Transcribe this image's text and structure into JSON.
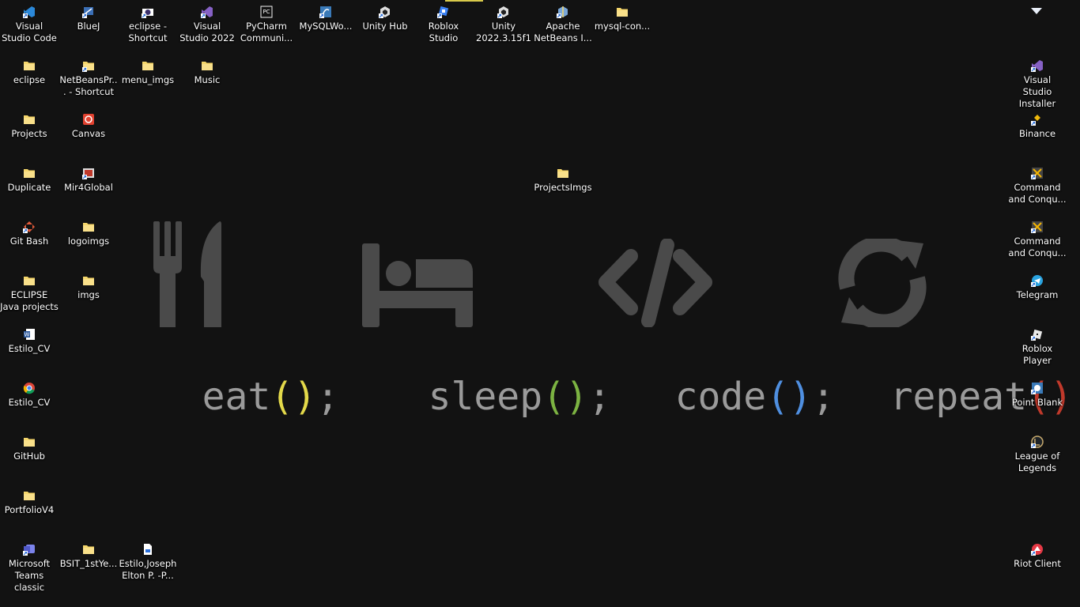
{
  "wallpaper": {
    "words": [
      {
        "name": "eat",
        "text": "eat",
        "open": "(",
        "close": ")",
        "semi": ";",
        "paren_color": "#e3d94a",
        "icon": "fork-knife-icon"
      },
      {
        "name": "sleep",
        "text": "sleep",
        "open": "(",
        "close": ")",
        "semi": ";",
        "paren_color": "#7cb342",
        "icon": "bed-icon"
      },
      {
        "name": "code",
        "text": "code",
        "open": "(",
        "close": ")",
        "semi": ";",
        "paren_color": "#4f8fe0",
        "icon": "code-brackets-icon"
      },
      {
        "name": "repeat",
        "text": "repeat",
        "open": "(",
        "close": ")",
        "semi": ";",
        "paren_color": "#c0392b",
        "icon": "refresh-icon"
      }
    ],
    "icon_color": "#4a4a4a",
    "text_color": "#9a9a9a"
  },
  "desktop": {
    "icons": [
      {
        "id": "vscode",
        "label": "Visual Studio Code",
        "icon": "vscode-icon",
        "color": "#2b88d8"
      },
      {
        "id": "bluej",
        "label": "BlueJ",
        "icon": "bluej-icon",
        "color": "#3b6fb6"
      },
      {
        "id": "eclipse-shortcut",
        "label": "eclipse - Shortcut",
        "icon": "eclipse-icon",
        "color": "#3a2f6b"
      },
      {
        "id": "vs2022",
        "label": "Visual Studio 2022",
        "icon": "visual-studio-icon",
        "color": "#8661c5"
      },
      {
        "id": "pycharm",
        "label": "PyCharm Communi...",
        "icon": "pycharm-icon",
        "color": "#f2f2f2"
      },
      {
        "id": "mysql-workbench",
        "label": "MySQLWo...",
        "icon": "mysql-workbench-icon",
        "color": "#3a7ab8"
      },
      {
        "id": "unity-hub",
        "label": "Unity Hub",
        "icon": "unity-hub-icon",
        "color": "#dddddd"
      },
      {
        "id": "roblox-studio",
        "label": "Roblox Studio",
        "icon": "roblox-studio-icon",
        "color": "#3b82f6"
      },
      {
        "id": "unity",
        "label": "Unity 2022.3.15f1",
        "icon": "unity-icon",
        "color": "#dddddd"
      },
      {
        "id": "netbeans",
        "label": "Apache NetBeans I...",
        "icon": "netbeans-icon",
        "color": "#7aa7d8"
      },
      {
        "id": "mysql-con",
        "label": "mysql-con...",
        "icon": "folder-icon",
        "color": "#f5d66b"
      },
      {
        "id": "eclipse-folder",
        "label": "eclipse",
        "icon": "folder-icon",
        "color": "#f5d66b"
      },
      {
        "id": "netbeanspr",
        "label": "NetBeansPr... - Shortcut",
        "icon": "folder-shortcut-icon",
        "color": "#f5d66b"
      },
      {
        "id": "menu-imgs",
        "label": "menu_imgs",
        "icon": "folder-icon",
        "color": "#f5d66b"
      },
      {
        "id": "music",
        "label": "Music",
        "icon": "folder-icon",
        "color": "#f5d66b"
      },
      {
        "id": "projects",
        "label": "Projects",
        "icon": "folder-icon",
        "color": "#f5d66b"
      },
      {
        "id": "canvas",
        "label": "Canvas",
        "icon": "canvas-icon",
        "color": "#e2412f"
      },
      {
        "id": "duplicate",
        "label": "Duplicate",
        "icon": "folder-icon",
        "color": "#f5d66b"
      },
      {
        "id": "mir4global",
        "label": "Mir4Global",
        "icon": "mir4-icon",
        "color": "#cccccc"
      },
      {
        "id": "projectsimgs",
        "label": "ProjectsImgs",
        "icon": "folder-icon",
        "color": "#f5d66b"
      },
      {
        "id": "gitbash",
        "label": "Git Bash",
        "icon": "git-bash-icon",
        "color": "#e05a3a"
      },
      {
        "id": "logoimgs",
        "label": "logoimgs",
        "icon": "folder-icon",
        "color": "#f5d66b"
      },
      {
        "id": "eclipse-java",
        "label": "ECLIPSE Java projects",
        "icon": "folder-icon",
        "color": "#f5d66b"
      },
      {
        "id": "imgs",
        "label": "imgs",
        "icon": "folder-icon",
        "color": "#f5d66b"
      },
      {
        "id": "estilo-cv-word",
        "label": "Estilo_CV",
        "icon": "word-doc-icon",
        "color": "#2b579a"
      },
      {
        "id": "estilo-cv-chrome",
        "label": "Estilo_CV",
        "icon": "chrome-icon",
        "color": "#db4437"
      },
      {
        "id": "github",
        "label": "GitHub",
        "icon": "folder-icon",
        "color": "#f5d66b"
      },
      {
        "id": "portfoliov4",
        "label": "PortfolioV4",
        "icon": "folder-icon",
        "color": "#f5d66b"
      },
      {
        "id": "teams",
        "label": "Microsoft Teams classic",
        "icon": "teams-icon",
        "color": "#5059c9"
      },
      {
        "id": "bsit",
        "label": "BSIT_1stYe...",
        "icon": "folder-icon",
        "color": "#f5d66b"
      },
      {
        "id": "estilo-joseph",
        "label": "Estilo,Joseph Elton P. -P...",
        "icon": "document-icon",
        "color": "#e8eef8"
      },
      {
        "id": "vs-installer",
        "label": "Visual Studio Installer",
        "icon": "vs-installer-icon",
        "color": "#8661c5"
      },
      {
        "id": "binance",
        "label": "Binance",
        "icon": "binance-icon",
        "color": "#f0b90b"
      },
      {
        "id": "cnc1",
        "label": "Command and Conqu...",
        "icon": "command-conquer-icon",
        "color": "#cccccc"
      },
      {
        "id": "cnc2",
        "label": "Command and Conqu...",
        "icon": "command-conquer-icon",
        "color": "#cccccc"
      },
      {
        "id": "telegram",
        "label": "Telegram",
        "icon": "telegram-icon",
        "color": "#2aa3df"
      },
      {
        "id": "roblox-player",
        "label": "Roblox Player",
        "icon": "roblox-player-icon",
        "color": "#e8e8e8"
      },
      {
        "id": "point-blank",
        "label": "Point Blank",
        "icon": "point-blank-icon",
        "color": "#3a7ab8"
      },
      {
        "id": "lol",
        "label": "League of Legends",
        "icon": "league-icon",
        "color": "#c8aa6e"
      },
      {
        "id": "riot",
        "label": "Riot Client",
        "icon": "riot-client-icon",
        "color": "#e63946"
      }
    ]
  }
}
